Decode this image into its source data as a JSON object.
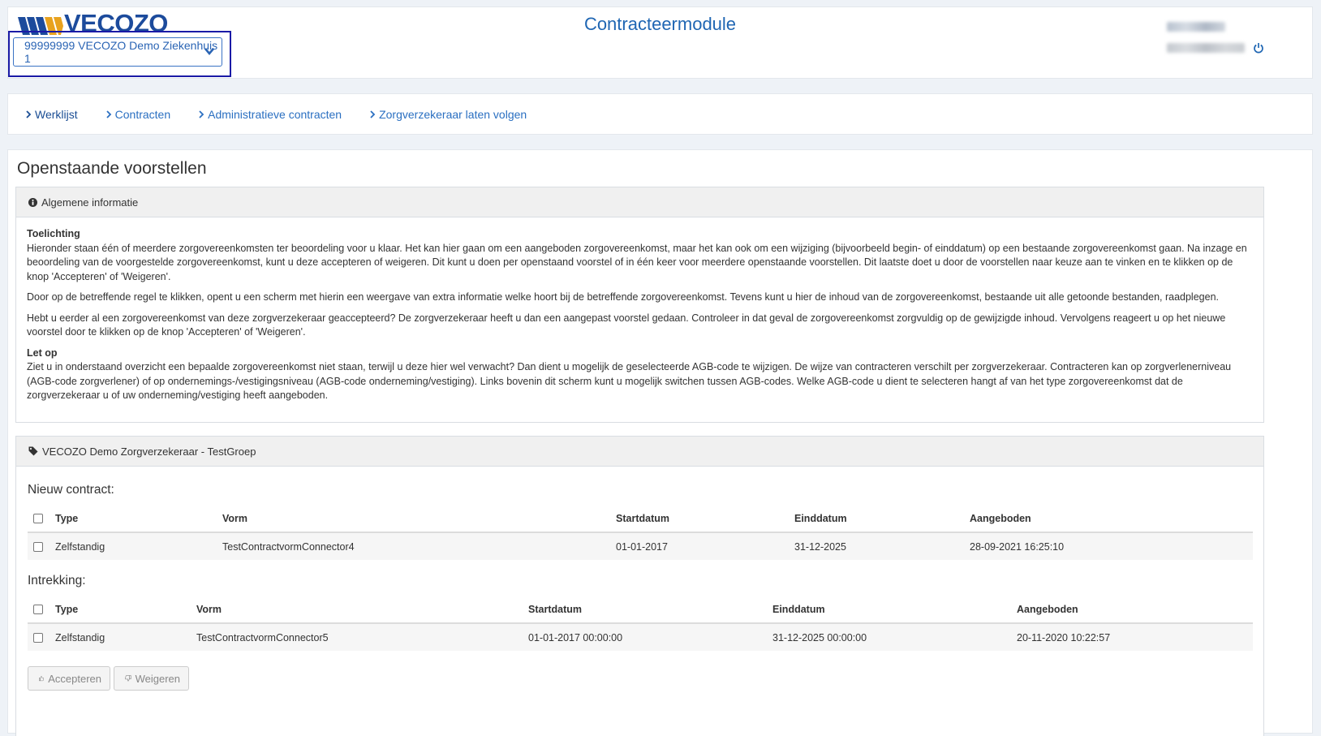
{
  "brand": {
    "logo_text": "VECOZO",
    "accent": "#1f66b3"
  },
  "header": {
    "app_title": "Contracteermodule",
    "org_select_value": "99999999 VECOZO Demo Ziekenhuis 1"
  },
  "nav": {
    "items": [
      {
        "label": "Werklijst"
      },
      {
        "label": "Contracten"
      },
      {
        "label": "Administratieve contracten"
      },
      {
        "label": "Zorgverzekeraar laten volgen"
      }
    ]
  },
  "main": {
    "title": "Openstaande voorstellen",
    "info_panel": {
      "heading": "Algemene informatie",
      "toelichting_title": "Toelichting",
      "p1": "Hieronder staan één of meerdere zorgovereenkomsten ter beoordeling voor u klaar. Het kan hier gaan om een aangeboden zorgovereenkomst, maar het kan ook om een wijziging (bijvoorbeeld begin- of einddatum) op een bestaande zorgovereenkomst gaan. Na inzage en beoordeling van de voorgestelde zorgovereenkomst, kunt u deze accepteren of weigeren. Dit kunt u doen per openstaand voorstel of in één keer voor meerdere openstaande voorstellen. Dit laatste doet u door de voorstellen naar keuze aan te vinken en te klikken op de knop 'Accepteren' of 'Weigeren'.",
      "p2": "Door op de betreffende regel te klikken, opent u een scherm met hierin een weergave van extra informatie welke hoort bij de betreffende zorgovereenkomst. Tevens kunt u hier de inhoud van de zorgovereenkomst, bestaande uit alle getoonde bestanden, raadplegen.",
      "p3": "Hebt u eerder al een zorgovereenkomst van deze zorgverzekeraar geaccepteerd? De zorgverzekeraar heeft u dan een aangepast voorstel gedaan. Controleer in dat geval de zorgovereenkomst zorgvuldig op de gewijzigde inhoud. Vervolgens reageert u op het nieuwe voorstel door te klikken op de knop 'Accepteren' of 'Weigeren'.",
      "letop_title": "Let op",
      "p4": "Ziet u in onderstaand overzicht een bepaalde zorgovereenkomst niet staan, terwijl u deze hier wel verwacht? Dan dient u mogelijk de geselecteerde AGB-code te wijzigen. De wijze van contracteren verschilt per zorgverzekeraar. Contracteren kan op zorgverlenerniveau (AGB-code zorgverlener) of op ondernemings-/vestigingsniveau (AGB-code onderneming/vestiging). Links bovenin dit scherm kunt u mogelijk switchen tussen AGB-codes. Welke AGB-code u dient te selecteren hangt af van het type zorgovereenkomst dat de zorgverzekeraar u of uw onderneming/vestiging heeft aangeboden."
    },
    "insurer_panel": {
      "heading": "VECOZO Demo Zorgverzekeraar - TestGroep",
      "new_contract": {
        "label": "Nieuw contract:",
        "columns": [
          "Type",
          "Vorm",
          "Startdatum",
          "Einddatum",
          "Aangeboden"
        ],
        "rows": [
          [
            "Zelfstandig",
            "TestContractvormConnector4",
            "01-01-2017",
            "31-12-2025",
            "28-09-2021 16:25:10"
          ]
        ]
      },
      "withdrawal": {
        "label": "Intrekking:",
        "columns": [
          "Type",
          "Vorm",
          "Startdatum",
          "Einddatum",
          "Aangeboden"
        ],
        "rows": [
          [
            "Zelfstandig",
            "TestContractvormConnector5",
            "01-01-2017 00:00:00",
            "31-12-2025 00:00:00",
            "20-11-2020 10:22:57"
          ]
        ]
      },
      "accept_label": "Accepteren",
      "reject_label": "Weigeren"
    }
  }
}
